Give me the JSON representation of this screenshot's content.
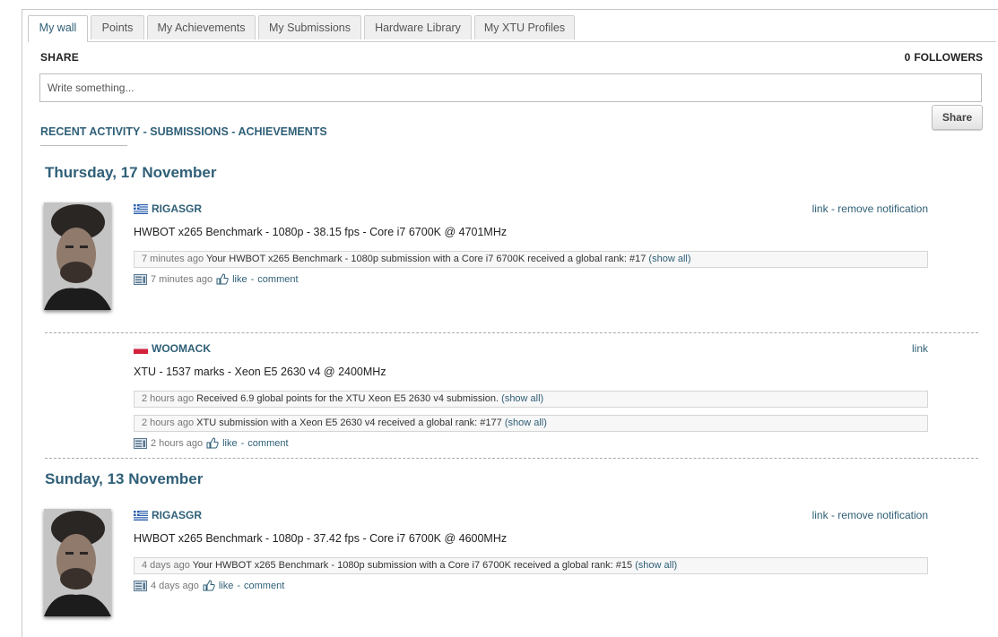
{
  "tabs": [
    {
      "label": "My wall"
    },
    {
      "label": "Points"
    },
    {
      "label": "My Achievements"
    },
    {
      "label": "My Submissions"
    },
    {
      "label": "Hardware Library"
    },
    {
      "label": "My XTU Profiles"
    }
  ],
  "share": {
    "label": "SHARE",
    "followers_count": "0",
    "followers_label": "FOLLOWERS",
    "placeholder": "Write something...",
    "button_label": "Share"
  },
  "filters": {
    "recent": "RECENT ACTIVITY",
    "submissions": "SUBMISSIONS",
    "achievements": "ACHIEVEMENTS",
    "separator": "-"
  },
  "days": [
    {
      "date": "Thursday, 17 November",
      "entries": [
        {
          "user": "RIGASGR",
          "flag": "greece",
          "title": "HWBOT x265 Benchmark - 1080p - 38.15 fps - Core i7 6700K @ 4701MHz",
          "link": "link",
          "remove": "remove notification",
          "notifications": [
            {
              "time": "7 minutes ago",
              "text": "Your HWBOT x265 Benchmark - 1080p submission with a Core i7 6700K received a global rank: #17",
              "show_all": "(show all)"
            }
          ],
          "meta": {
            "time": "7 minutes ago",
            "like": "like",
            "comment": "comment"
          }
        },
        {
          "user": "WOOMACK",
          "flag": "poland",
          "title": "XTU - 1537 marks - Xeon E5 2630 v4 @ 2400MHz",
          "link": "link",
          "notifications": [
            {
              "time": "2 hours ago",
              "text": "Received 6.9 global points for the XTU Xeon E5 2630 v4 submission.",
              "show_all": "(show all)"
            },
            {
              "time": "2 hours ago",
              "text": "XTU submission with a Xeon E5 2630 v4 received a global rank: #177",
              "show_all": "(show all)"
            }
          ],
          "meta": {
            "time": "2 hours ago",
            "like": "like",
            "comment": "comment"
          }
        }
      ]
    },
    {
      "date": "Sunday, 13 November",
      "entries": [
        {
          "user": "RIGASGR",
          "flag": "greece",
          "title": "HWBOT x265 Benchmark - 1080p - 37.42 fps - Core i7 6700K @ 4600MHz",
          "link": "link",
          "remove": "remove notification",
          "notifications": [
            {
              "time": "4 days ago",
              "text": "Your HWBOT x265 Benchmark - 1080p submission with a Core i7 6700K received a global rank: #15",
              "show_all": "(show all)"
            }
          ],
          "meta": {
            "time": "4 days ago",
            "like": "like",
            "comment": "comment"
          }
        }
      ]
    }
  ],
  "colors": {
    "accent": "#2f5f77",
    "greece_blue": "#2b5fae",
    "poland_red": "#d4213d"
  }
}
